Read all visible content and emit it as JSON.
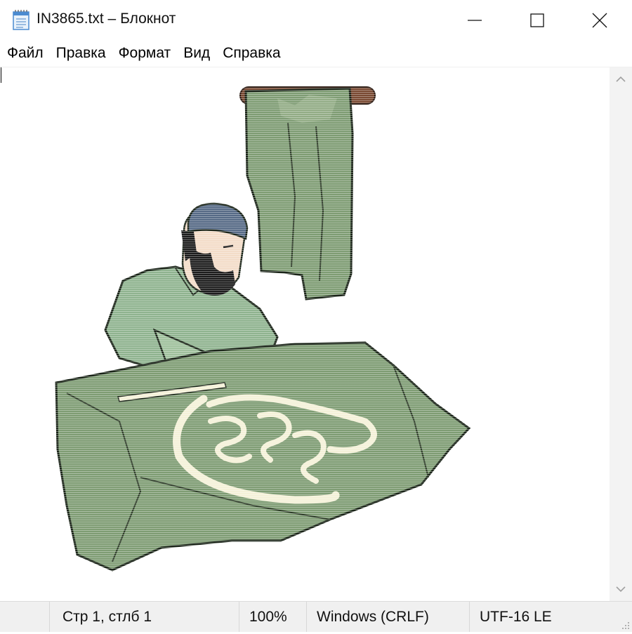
{
  "window": {
    "title": "IN3865.txt – Блокнот",
    "icon": "notepad-icon",
    "controls": {
      "minimize": "minimize-icon",
      "maximize": "maximize-icon",
      "close": "close-icon"
    }
  },
  "menu": {
    "items": [
      {
        "label": "Файл"
      },
      {
        "label": "Правка"
      },
      {
        "label": "Формат"
      },
      {
        "label": "Вид"
      },
      {
        "label": "Справка"
      }
    ]
  },
  "editor": {
    "content": "clip-art illustration: bearded man in cap embroidering a green cloth with calligraphy, green garment hanging on a rod",
    "colors": {
      "cloth": "#7e9c73",
      "shirt": "#8fb38f",
      "skin": "#f3dcc8",
      "cap": "#566a86",
      "rod": "#7a4a33",
      "thread": "#f4f1d8"
    }
  },
  "statusbar": {
    "position": "Стр 1, стлб 1",
    "zoom": "100%",
    "line_endings": "Windows (CRLF)",
    "encoding": "UTF-16 LE"
  }
}
